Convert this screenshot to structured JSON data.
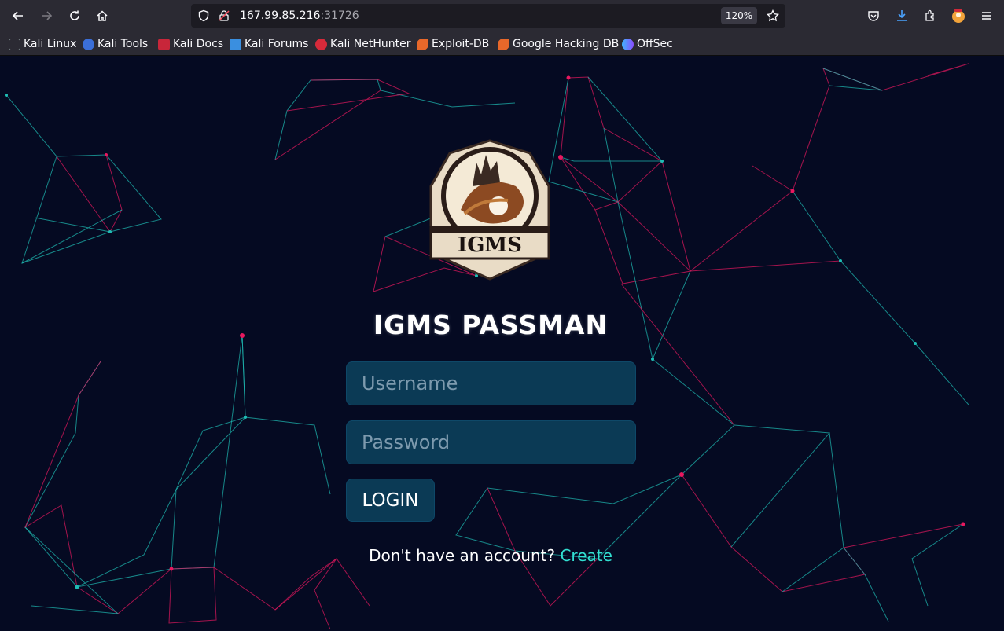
{
  "browser": {
    "url_host": "167.99.85.216",
    "url_port": ":31726",
    "zoom": "120%",
    "bookmarks": [
      {
        "label": "Kali Linux",
        "icon": "kali-dragon-icon"
      },
      {
        "label": "Kali Tools",
        "icon": "kali-tools-icon"
      },
      {
        "label": "Kali Docs",
        "icon": "kali-docs-icon"
      },
      {
        "label": "Kali Forums",
        "icon": "kali-forums-icon"
      },
      {
        "label": "Kali NetHunter",
        "icon": "kali-nethunter-icon"
      },
      {
        "label": "Exploit-DB",
        "icon": "exploit-db-icon"
      },
      {
        "label": "Google Hacking DB",
        "icon": "ghdb-icon"
      },
      {
        "label": "OffSec",
        "icon": "offsec-icon"
      }
    ]
  },
  "page": {
    "logo_text": "IGMS",
    "title": "IGMS PASSMAN",
    "username_placeholder": "Username",
    "password_placeholder": "Password",
    "login_label": "LOGIN",
    "signup_prompt": "Don't have an account?",
    "signup_link": "Create"
  },
  "colors": {
    "background": "#050a22",
    "input_bg": "#0b3a55",
    "link": "#32e0d2",
    "network_pink": "#e8185f",
    "network_teal": "#1fbdb5"
  }
}
